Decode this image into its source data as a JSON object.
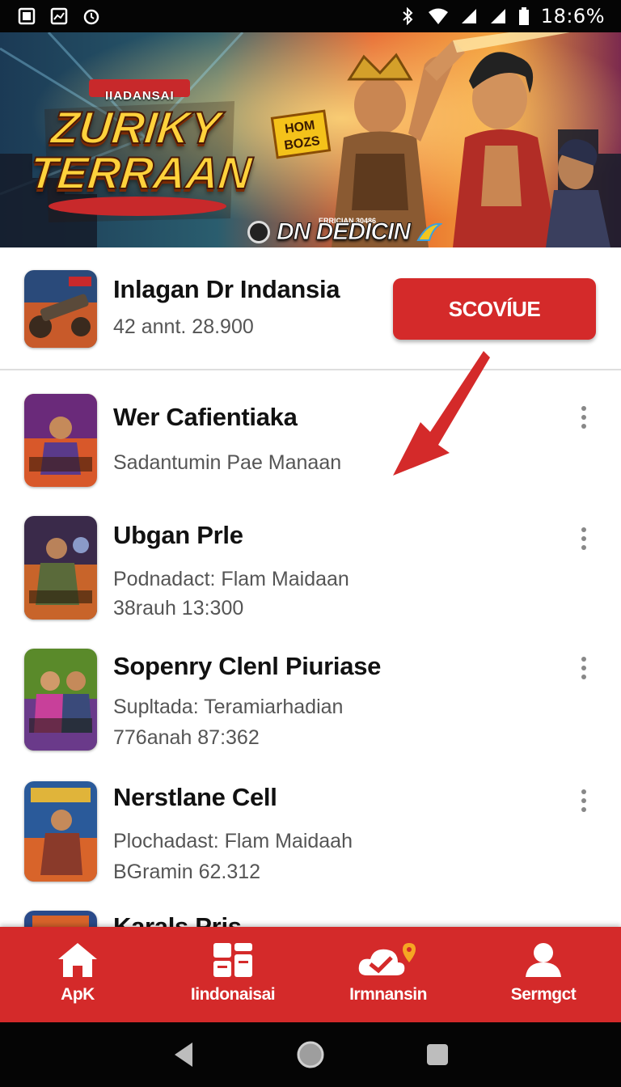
{
  "status_bar": {
    "time": "18:6%",
    "left_icons": [
      "photo-icon",
      "chart-icon",
      "alarm-icon"
    ],
    "right_icons": [
      "bluetooth-icon",
      "wifi-icon",
      "signal-icon",
      "signal-icon",
      "battery-icon"
    ]
  },
  "hero": {
    "tag": "IIADANSAI",
    "title_line1": "ZURIKY",
    "title_line2": "TERRAAN",
    "badge_line1": "HOM",
    "badge_line2": "BOZS",
    "brand_small": "ERRICIAN 30486",
    "brand": "DN DEDICIN"
  },
  "featured": {
    "title": "Inlagan Dr Indansia",
    "subtitle": "42 annt. 28.900",
    "button_label": "SCOVÍUE"
  },
  "list": [
    {
      "title": "Wer Cafientiaka",
      "line1": "Sadantumin Pae Manaan",
      "line2": ""
    },
    {
      "title": "Ubgan Prle",
      "line1": "Podnadact: Flam Maidaan",
      "line2": "38rauh  13:300"
    },
    {
      "title": "Sopenry Clenl Piuriase",
      "line1": "Supltada: Teramiarhadian",
      "line2": "776anah  87:362"
    },
    {
      "title": "Nerstlane Cell",
      "line1": "Plochadast: Flam Maidaah",
      "line2": "BGramin 62.312"
    },
    {
      "title": "Karals Pris",
      "line1": "",
      "line2": ""
    }
  ],
  "bottom_nav": [
    {
      "label": "ApK",
      "icon": "home-icon"
    },
    {
      "label": "Iindonaisai",
      "icon": "dashboard-icon"
    },
    {
      "label": "Irmnansin",
      "icon": "cloud-check-icon"
    },
    {
      "label": "Sermgct",
      "icon": "profile-icon"
    }
  ],
  "colors": {
    "accent": "#d42a2a",
    "status_bar": "#050505",
    "title_text": "#111111",
    "sub_text": "#555555"
  }
}
